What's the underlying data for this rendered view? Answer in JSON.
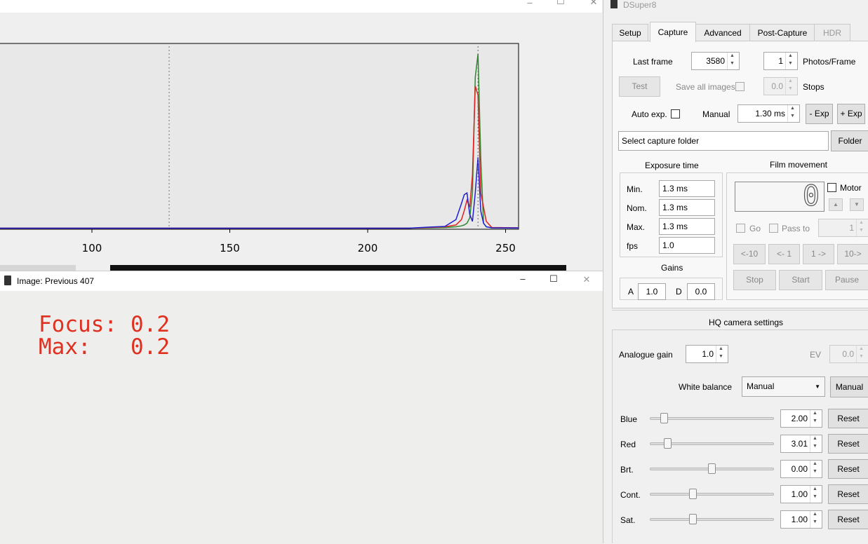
{
  "histogram_window": {
    "x_ticks": [
      "100",
      "150",
      "200",
      "250"
    ]
  },
  "image_window": {
    "title": "Image: Previous 407",
    "overlay": {
      "focus_label": "Focus:",
      "focus_value": "0.2",
      "max_label": "Max:",
      "max_value": "0.2"
    }
  },
  "chart_data": {
    "type": "line",
    "x": [
      0,
      215,
      222,
      228,
      232,
      234,
      235,
      236,
      237,
      238,
      239,
      240,
      241,
      242,
      243,
      245,
      255
    ],
    "xlim": [
      50,
      255
    ],
    "ylim": [
      0,
      1
    ],
    "threshold_line_x": 128,
    "series": [
      {
        "color": "#2c8a2c",
        "values": [
          0.002,
          0.002,
          0.004,
          0.006,
          0.01,
          0.015,
          0.02,
          0.03,
          0.06,
          0.2,
          0.85,
          0.98,
          0.4,
          0.03,
          0.01,
          0.004,
          0.004
        ]
      },
      {
        "color": "#e02020",
        "values": [
          0.002,
          0.002,
          0.006,
          0.01,
          0.02,
          0.05,
          0.1,
          0.16,
          0.12,
          0.3,
          0.8,
          0.75,
          0.2,
          0.12,
          0.04,
          0.006,
          0.004
        ]
      },
      {
        "color": "#2020d0",
        "values": [
          0.002,
          0.002,
          0.008,
          0.012,
          0.05,
          0.14,
          0.19,
          0.2,
          0.08,
          0.04,
          0.2,
          0.4,
          0.1,
          0.03,
          0.01,
          0.004,
          0.003
        ]
      }
    ]
  },
  "dsuper8": {
    "window_title": "DSuper8",
    "tabs": [
      "Setup",
      "Capture",
      "Advanced",
      "Post-Capture",
      "HDR"
    ],
    "active_tab": "Capture",
    "capture": {
      "last_frame_label": "Last frame",
      "last_frame_value": "3580",
      "photos_per_frame_value": "1",
      "photos_per_frame_label": "Photos/Frame",
      "test_button": "Test",
      "save_all_images_label": "Save all images",
      "stops_value": "0.0",
      "stops_label": "Stops",
      "auto_exp_label": "Auto exp.",
      "manual_label": "Manual",
      "manual_exposure_value": "1.30 ms",
      "minus_exp_button": "- Exp",
      "plus_exp_button": "+ Exp",
      "capture_folder_value": "Select capture folder",
      "folder_button": "Folder",
      "exposure_time_title": "Exposure time",
      "exposure_rows": [
        {
          "label": "Min.",
          "value": "1.3 ms"
        },
        {
          "label": "Nom.",
          "value": "1.3 ms"
        },
        {
          "label": "Max.",
          "value": "1.3 ms"
        },
        {
          "label": "fps",
          "value": "1.0"
        }
      ],
      "gains_title": "Gains",
      "gain_a_label": "A",
      "gain_a_value": "1.0",
      "gain_d_label": "D",
      "gain_d_value": "0.0",
      "film_movement_title": "Film movement",
      "frame_counter_value": "0",
      "motor_label": "Motor",
      "go_label": "Go",
      "pass_to_label": "Pass to",
      "pass_to_value": "1",
      "move_buttons": [
        "<-10",
        "<- 1",
        "1 ->",
        "10->"
      ],
      "stop_button": "Stop",
      "start_button": "Start",
      "pause_button": "Pause"
    },
    "hq_camera": {
      "title": "HQ camera settings",
      "analogue_gain_label": "Analogue gain",
      "analogue_gain_value": "1.0",
      "ev_label": "EV",
      "ev_value": "0.0",
      "white_balance_label": "White balance",
      "white_balance_selected": "Manual",
      "white_balance_button": "Manual",
      "reset_label": "Reset",
      "sliders": [
        {
          "label": "Blue",
          "value": "2.00",
          "level": 0.09
        },
        {
          "label": "Red",
          "value": "3.01",
          "level": 0.12
        },
        {
          "label": "Brt.",
          "value": "0.00",
          "level": 0.5
        },
        {
          "label": "Cont.",
          "value": "1.00",
          "level": 0.34
        },
        {
          "label": "Sat.",
          "value": "1.00",
          "level": 0.34
        }
      ]
    }
  }
}
